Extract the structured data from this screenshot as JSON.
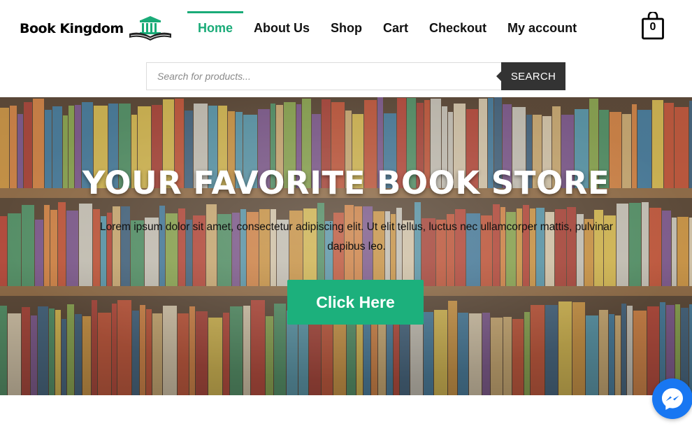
{
  "brand": {
    "name": "Book Kingdom",
    "accent_color": "#1aab78"
  },
  "nav": {
    "items": [
      {
        "label": "Home",
        "active": true
      },
      {
        "label": "About Us",
        "active": false
      },
      {
        "label": "Shop",
        "active": false
      },
      {
        "label": "Cart",
        "active": false
      },
      {
        "label": "Checkout",
        "active": false
      },
      {
        "label": "My account",
        "active": false
      }
    ]
  },
  "cart": {
    "count": "0",
    "icon": "shopping-bag-icon"
  },
  "search": {
    "placeholder": "Search for products...",
    "value": "",
    "button_label": "SEARCH"
  },
  "hero": {
    "title": "YOUR FAVORITE BOOK STORE",
    "text": "Lorem ipsum dolor sit amet, consectetur adipiscing elit. Ut elit tellus, luctus nec ullamcorper mattis, pulvinar dapibus leo.",
    "button_label": "Click Here",
    "button_color": "#1cb07c"
  },
  "chat_widget": {
    "icon": "messenger-icon",
    "color": "#1877f2"
  }
}
